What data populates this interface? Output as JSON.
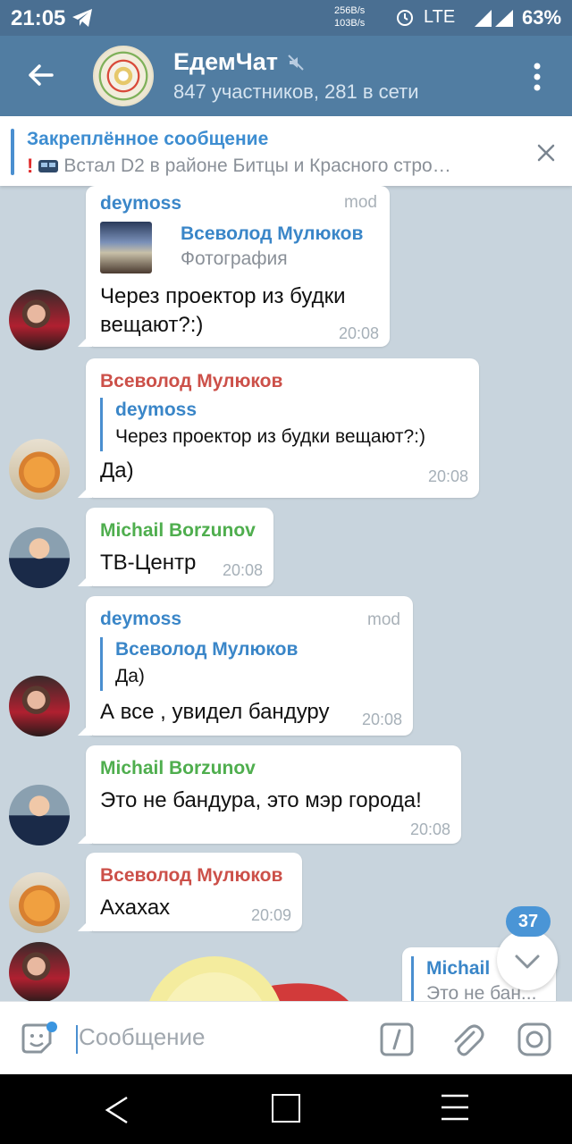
{
  "status_bar": {
    "time": "21:05",
    "speed_up": "256B/s",
    "speed_down": "103B/s",
    "network": "LTE",
    "battery": "63%"
  },
  "header": {
    "title": "ЕдемЧат",
    "subtitle": "847 участников, 281 в сети"
  },
  "pinned": {
    "title": "Закреплённое сообщение",
    "excl": "!",
    "text": "Встал D2 в районе Битцы и Красного стро…"
  },
  "messages": [
    {
      "sender": "deymoss",
      "tag": "mod",
      "reply_name": "Всеволод Мулюков",
      "reply_text": "Фотография",
      "text_line1": "Через проектор из будки",
      "text_line2": "вещают?:)",
      "time": "20:08"
    },
    {
      "sender": "Всеволод Мулюков",
      "reply_name": "deymoss",
      "reply_text": "Через проектор из будки вещают?:)",
      "text": "Да)",
      "time": "20:08"
    },
    {
      "sender": "Michail Borzunov",
      "text": "ТВ-Центр",
      "time": "20:08"
    },
    {
      "sender": "deymoss",
      "tag": "mod",
      "reply_name": "Всеволод Мулюков",
      "reply_text": "Да)",
      "text": "А все , увидел бандуру",
      "time": "20:08"
    },
    {
      "sender": "Michail Borzunov",
      "text": "Это не бандура, это мэр города!",
      "time": "20:08"
    },
    {
      "sender": "Всеволод Мулюков",
      "text": "Ахахах",
      "time": "20:09"
    }
  ],
  "partial_reply": {
    "name": "Michail",
    "text": "Это не бан..."
  },
  "unread_count": "37",
  "input": {
    "placeholder": "Сообщение"
  },
  "colors": {
    "header": "#517da2",
    "accent": "#3a86c8",
    "red_name": "#cc5049",
    "green_name": "#4fae4e"
  }
}
